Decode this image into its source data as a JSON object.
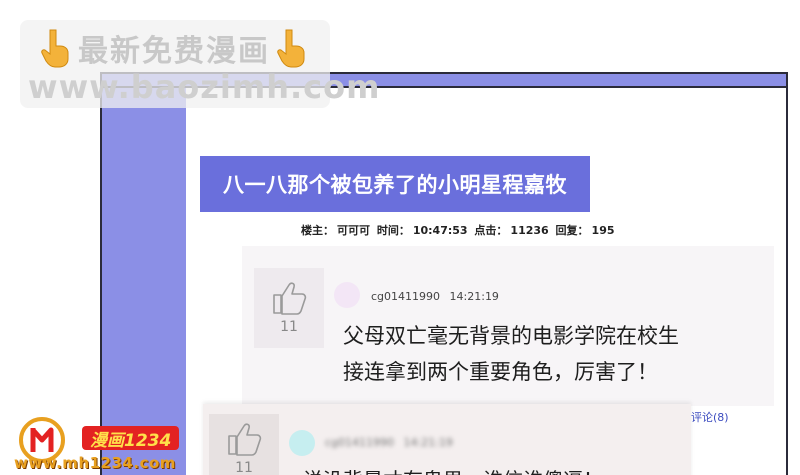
{
  "post": {
    "title": "八一八那个被包养了的小明星程嘉牧",
    "meta_author_label": "楼主：",
    "meta_author": "可可可",
    "meta_time_label": "时间：",
    "meta_time": "10:47:53",
    "meta_clicks_label": "点击：",
    "meta_clicks": "11236",
    "meta_replies_label": "回复：",
    "meta_replies": "195"
  },
  "comments": [
    {
      "likes": "11",
      "username": "cg01411990",
      "time": "14:21:19",
      "line1": "父母双亡毫无背景的电影学院在校生",
      "line2": "接连拿到两个重要角色，厉害了！",
      "reply_link": "评论(8)"
    },
    {
      "likes": "11",
      "username": "cg01411990",
      "time": "14:21:19",
      "line1": "说没背景才有鬼男，谁信谁傻逼！"
    }
  ],
  "watermark_top": {
    "line1": "最新免费漫画",
    "line2": "www.baozimh.com"
  },
  "watermark_bottom": {
    "badge": "漫画1234",
    "url": "www.mh1234.com"
  },
  "colors": {
    "frame": "#8b8fe6",
    "title_bg": "#6a6fdc",
    "link": "#3b4bbf",
    "badge_bg": "#e32222",
    "badge_text": "#ffe04a",
    "url_text": "#e8a020"
  },
  "icons": {
    "like": "thumbs-up-icon",
    "hand": "pointing-down-hand-icon",
    "logo": "mh-logo-icon"
  }
}
